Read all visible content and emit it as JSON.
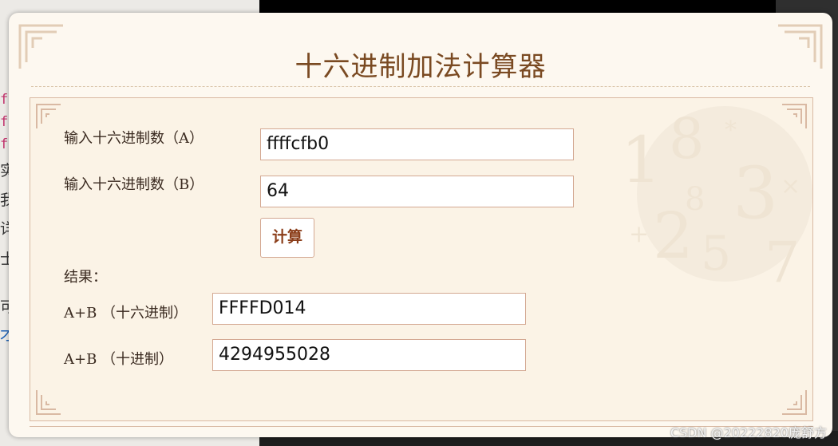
{
  "calculator": {
    "title": "十六进制加法计算器",
    "label_a": "输入十六进制数（A）",
    "value_a": "ffffcfb0",
    "label_b": "输入十六进制数（B）",
    "value_b": "64",
    "calculate_label": "计算",
    "result_label": "结果：",
    "hex_sum_label": "A+B （十六进制）",
    "hex_sum_value": "FFFFD014",
    "dec_sum_label": "A+B （十进制）",
    "dec_sum_value": "4294955028"
  },
  "watermark": "CSDN @20222820庞舒方",
  "background": {
    "glyphs": [
      "f",
      "f",
      "f",
      "实",
      "我",
      "详",
      "士",
      "可",
      "才"
    ]
  },
  "colors": {
    "modal_bg": "#fdf8f0",
    "title": "#7a4a22",
    "border": "#d3a892",
    "button_text": "#8b3e1a"
  }
}
